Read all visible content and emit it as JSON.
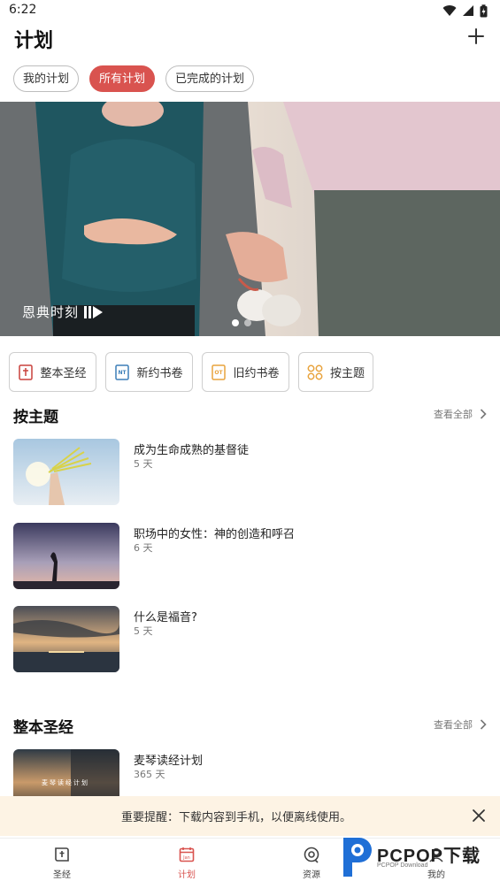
{
  "status_bar": {
    "time": "6:22"
  },
  "header": {
    "title": "计划"
  },
  "filter_tabs": [
    {
      "label": "我的计划",
      "active": false
    },
    {
      "label": "所有计划",
      "active": true
    },
    {
      "label": "已完成的计划",
      "active": false
    }
  ],
  "banner": {
    "logo_text": "恩典时刻",
    "slide_count": 2,
    "active_slide": 1
  },
  "categories": [
    {
      "label": "整本圣经",
      "icon": "bible-icon"
    },
    {
      "label": "新约书卷",
      "icon": "nt-icon",
      "badge": "NT"
    },
    {
      "label": "旧约书卷",
      "icon": "ot-icon",
      "badge": "OT"
    },
    {
      "label": "按主题",
      "icon": "topics-grid-icon"
    }
  ],
  "topic_section": {
    "title": "按主题",
    "view_all": "查看全部",
    "items": [
      {
        "title": "成为生命成熟的基督徒",
        "days": "5 天"
      },
      {
        "title": "职场中的女性：神的创造和呼召",
        "days": "6 天"
      },
      {
        "title": "什么是福音?",
        "days": "5 天"
      }
    ]
  },
  "bible_section": {
    "title": "整本圣经",
    "view_all": "查看全部",
    "items": [
      {
        "title": "麦琴读经计划",
        "days": "365 天",
        "thumb_text": "麦琴读经计划"
      }
    ]
  },
  "toast": {
    "text": "重要提醒：下载内容到手机，以便离线使用。"
  },
  "bottom_nav": [
    {
      "label": "圣经",
      "icon": "bible-book-icon",
      "active": false
    },
    {
      "label": "计划",
      "icon": "calendar-icon",
      "active": true,
      "icon_text": "Jan"
    },
    {
      "label": "资源",
      "icon": "resources-icon",
      "active": false
    },
    {
      "label": "我的",
      "icon": "profile-icon",
      "active": false
    }
  ],
  "watermark": {
    "text": "PCPOP下载",
    "sub": "PCPOP Download"
  },
  "colors": {
    "accent": "#d9534f",
    "toast_bg": "#fdf3e4",
    "ot_orange": "#e8a33d",
    "nt_blue": "#3d7fb8",
    "bible_red": "#c9413c"
  }
}
